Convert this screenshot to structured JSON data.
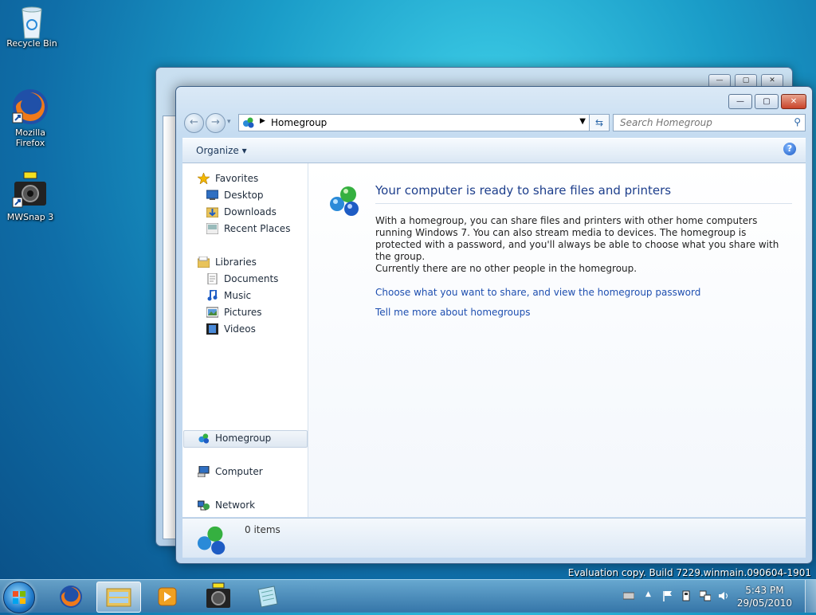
{
  "desktop": {
    "icons": [
      {
        "label": "Recycle Bin",
        "icon": "recycle-bin-icon"
      },
      {
        "label": "Mozilla Firefox",
        "icon": "firefox-icon"
      },
      {
        "label": "MWSnap 3",
        "icon": "camera-icon"
      }
    ],
    "watermark": "Evaluation copy. Build 7229.winmain.090604-1901"
  },
  "window": {
    "address": "Homegroup",
    "search_placeholder": "Search Homegroup",
    "organize_label": "Organize",
    "nav": {
      "favorites": "Favorites",
      "desktop": "Desktop",
      "downloads": "Downloads",
      "recent_places": "Recent Places",
      "libraries": "Libraries",
      "documents": "Documents",
      "music": "Music",
      "pictures": "Pictures",
      "videos": "Videos",
      "homegroup": "Homegroup",
      "computer": "Computer",
      "network": "Network"
    },
    "content": {
      "title": "Your computer is ready to share files and printers",
      "body": "With a homegroup, you can share files and printers with other home computers running Windows 7. You can also stream media to devices. The homegroup is protected with a password, and you'll always be able to choose what you share with the group.",
      "status": "Currently there are no other people in the homegroup.",
      "link_share": "Choose what you want to share, and view the homegroup password",
      "link_more": "Tell me more about homegroups"
    },
    "details": {
      "count": "0 items"
    }
  },
  "taskbar": {
    "time": "5:43 PM",
    "date": "29/05/2010"
  },
  "colors": {
    "link": "#1e4fb0",
    "title": "#1d3e8c"
  }
}
